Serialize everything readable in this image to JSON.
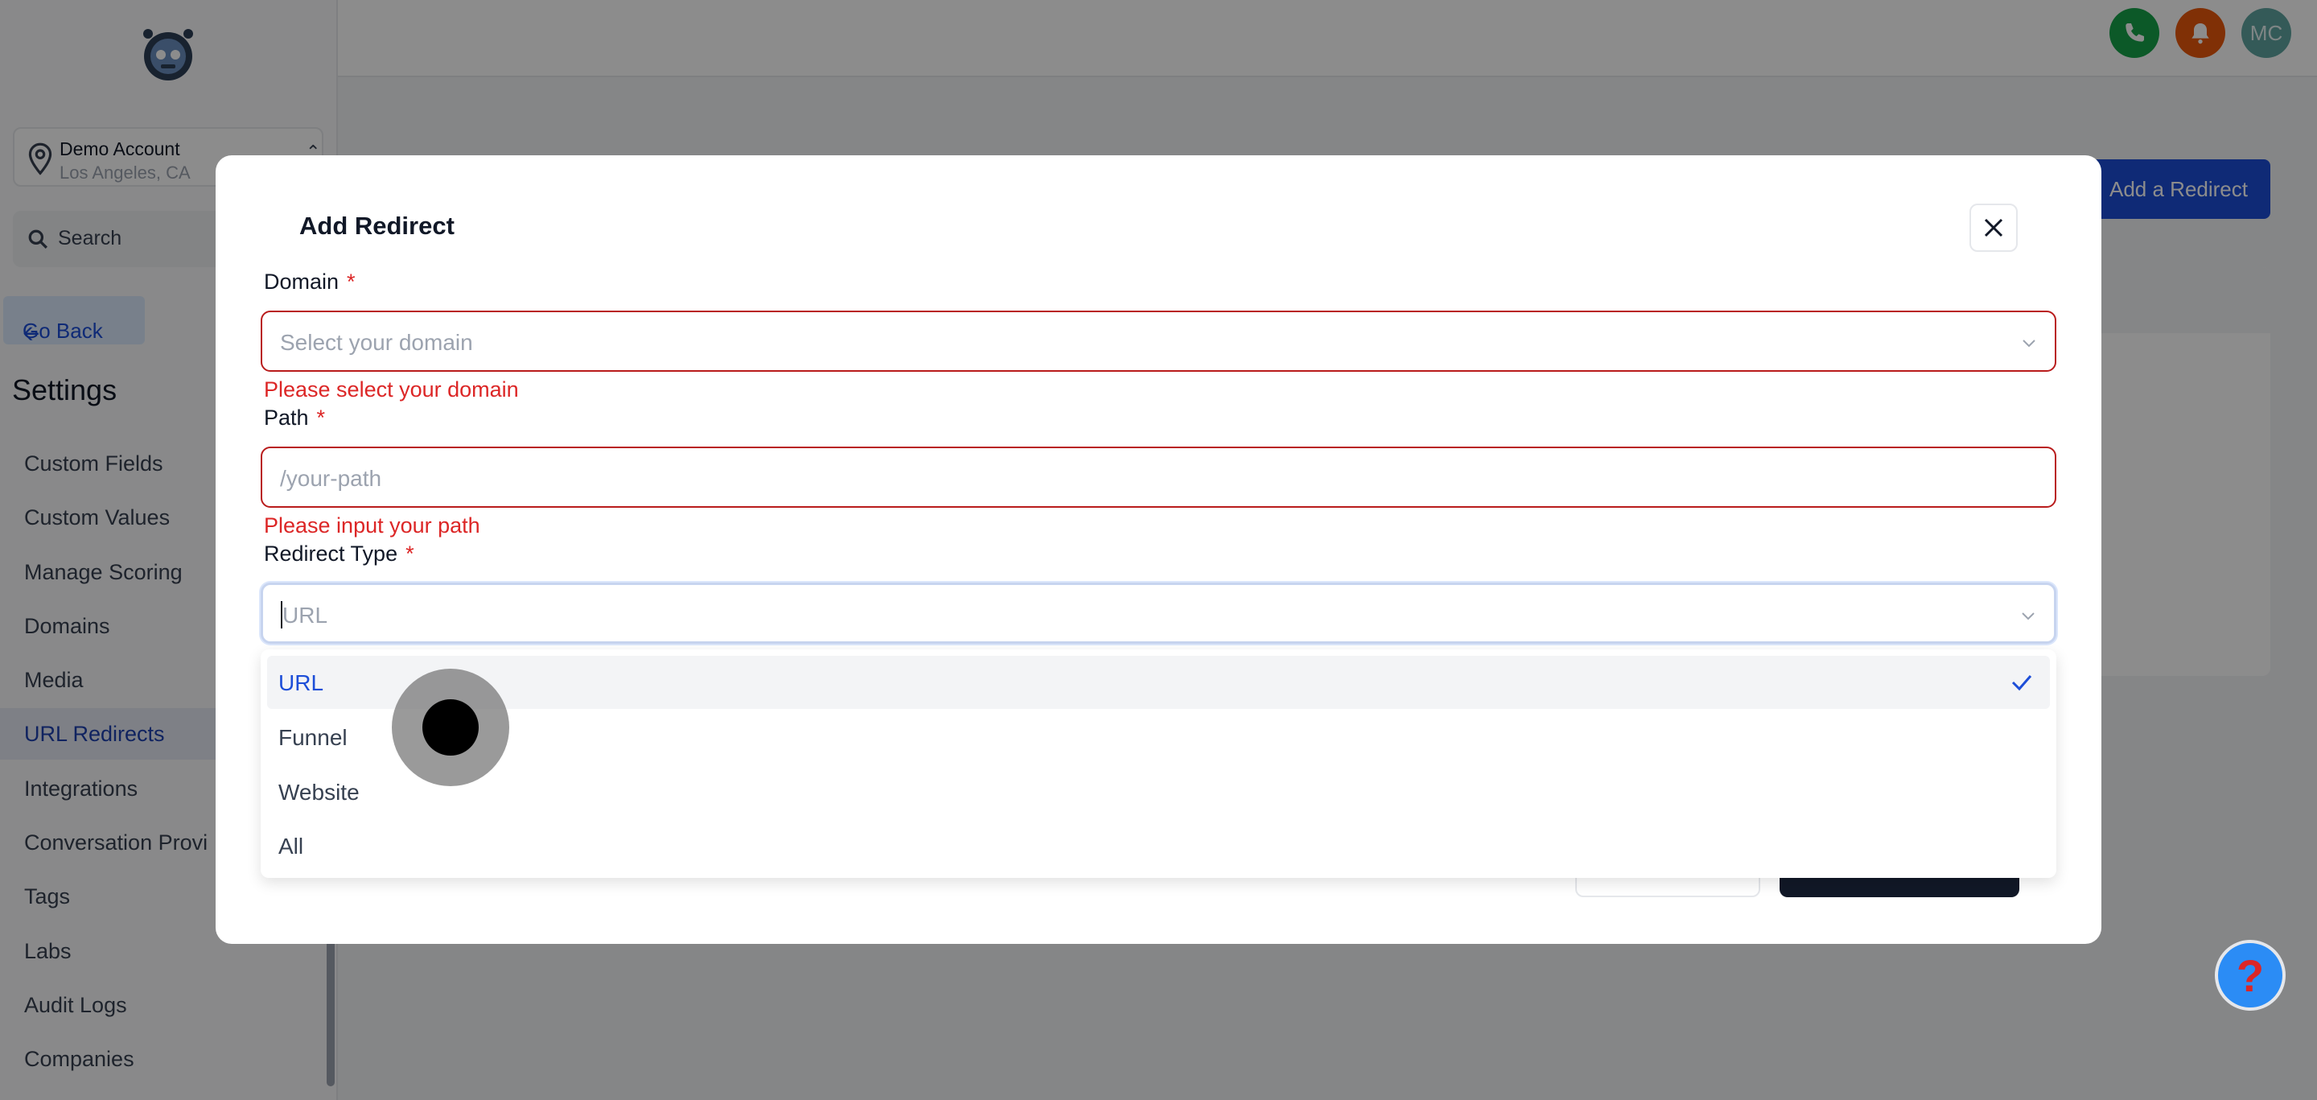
{
  "account": {
    "name": "Demo Account",
    "location": "Los Angeles, CA"
  },
  "sidebar": {
    "search_label": "Search",
    "go_back": "Go Back",
    "section_title": "Settings",
    "items": [
      {
        "label": "Custom Fields"
      },
      {
        "label": "Custom Values"
      },
      {
        "label": "Manage Scoring"
      },
      {
        "label": "Domains"
      },
      {
        "label": "Media"
      },
      {
        "label": "URL Redirects",
        "active": true
      },
      {
        "label": "Integrations"
      },
      {
        "label": "Conversation Provi"
      },
      {
        "label": "Tags"
      },
      {
        "label": "Labs"
      },
      {
        "label": "Audit Logs"
      },
      {
        "label": "Companies"
      }
    ]
  },
  "header": {
    "avatar_initials": "MC",
    "add_redirect_label": "Add a Redirect"
  },
  "help_button": "?",
  "modal": {
    "title": "Add Redirect",
    "required_marker": "*",
    "domain": {
      "label": "Domain",
      "placeholder": "Select your domain",
      "error": "Please select your domain"
    },
    "path": {
      "label": "Path",
      "placeholder": "/your-path",
      "error": "Please input your path"
    },
    "redirect_type": {
      "label": "Redirect Type",
      "placeholder": "URL",
      "options": [
        {
          "label": "URL",
          "selected": true
        },
        {
          "label": "Funnel"
        },
        {
          "label": "Website"
        },
        {
          "label": "All"
        }
      ]
    }
  },
  "colors": {
    "primary": "#1d4ed8",
    "error": "#dc2626",
    "phone_button": "#16a34a",
    "bell_button": "#ea580c",
    "avatar": "#60a5a0"
  }
}
